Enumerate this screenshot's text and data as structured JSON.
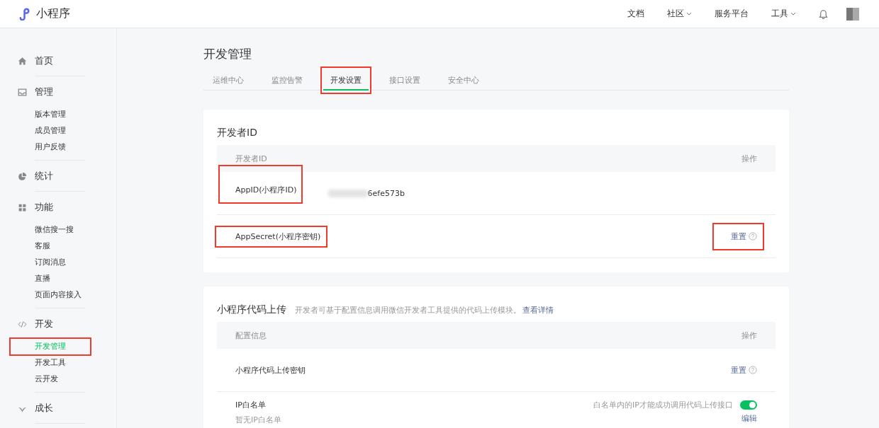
{
  "header": {
    "logo": "小程序",
    "nav": [
      {
        "label": "文档",
        "dropdown": false
      },
      {
        "label": "社区",
        "dropdown": true
      },
      {
        "label": "服务平台",
        "dropdown": false
      },
      {
        "label": "工具",
        "dropdown": true
      }
    ]
  },
  "sidebar": {
    "groups": [
      {
        "label": "首页"
      },
      {
        "label": "管理",
        "items": [
          {
            "label": "版本管理",
            "selected": false,
            "annotated": false
          },
          {
            "label": "成员管理",
            "selected": false,
            "annotated": false
          },
          {
            "label": "用户反馈",
            "selected": false,
            "annotated": false
          }
        ]
      },
      {
        "label": "统计"
      },
      {
        "label": "功能",
        "items": [
          {
            "label": "微信搜一搜",
            "selected": false,
            "annotated": false
          },
          {
            "label": "客服",
            "selected": false,
            "annotated": false
          },
          {
            "label": "订阅消息",
            "selected": false,
            "annotated": false
          },
          {
            "label": "直播",
            "selected": false,
            "annotated": false
          },
          {
            "label": "页面内容接入",
            "selected": false,
            "annotated": false
          }
        ]
      },
      {
        "label": "开发",
        "items": [
          {
            "label": "开发管理",
            "selected": true,
            "annotated": true
          },
          {
            "label": "开发工具",
            "selected": false,
            "annotated": false
          },
          {
            "label": "云开发",
            "selected": false,
            "annotated": false
          }
        ]
      },
      {
        "label": "成长"
      }
    ]
  },
  "page_title": "开发管理",
  "tabs": [
    {
      "label": "运维中心",
      "selected": false,
      "annotated": false
    },
    {
      "label": "监控告警",
      "selected": false,
      "annotated": false
    },
    {
      "label": "开发设置",
      "selected": true,
      "annotated": true
    },
    {
      "label": "接口设置",
      "selected": false,
      "annotated": false
    },
    {
      "label": "安全中心",
      "selected": false,
      "annotated": false
    }
  ],
  "cards": [
    {
      "title": "开发者ID",
      "columns": [
        "开发者ID",
        "操作"
      ],
      "rows": [
        {
          "label": "AppID(小程序ID)",
          "label_annotated": true,
          "value": "6efe573b",
          "value_redacted": true
        },
        {
          "label": "AppSecret(小程序密钥)",
          "label_annotated": true,
          "action": "重置",
          "help": true,
          "action_annotated": true
        }
      ]
    },
    {
      "title": "小程序代码上传",
      "description": "开发者可基于配置信息调用微信开发者工具提供的代码上传模块。",
      "link": "查看详情",
      "columns": [
        "配置信息",
        "操作"
      ],
      "rows": [
        {
          "label": "小程序代码上传密钥",
          "label_annotated": false,
          "action": "重置",
          "help": true,
          "action_annotated": false
        },
        {
          "label": "IP白名单",
          "sublabel": "暂无IP白名单",
          "note": "白名单内的IP才能成功调用代码上传接口",
          "toggle": {
            "on": true
          },
          "action": "编辑"
        }
      ]
    }
  ]
}
